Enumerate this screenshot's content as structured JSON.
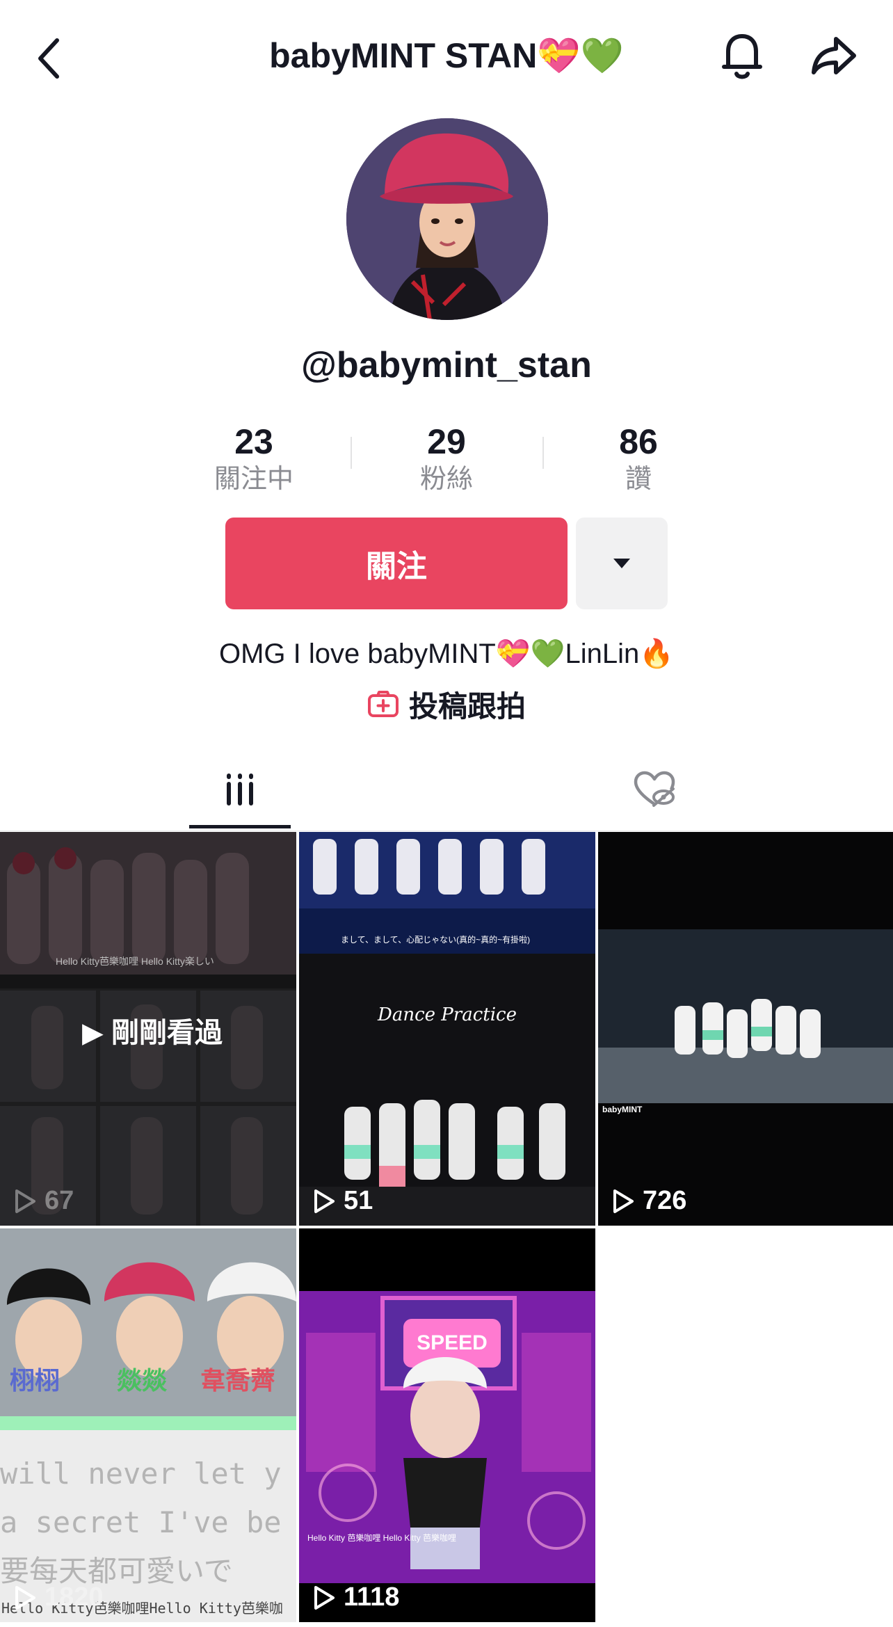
{
  "header": {
    "title": "babyMINT STAN💝💚",
    "back_icon": "chevron-left-icon",
    "bell_icon": "bell-icon",
    "share_icon": "share-arrow-icon"
  },
  "profile": {
    "username": "@babymint_stan",
    "stats": [
      {
        "value": "23",
        "label": "關注中"
      },
      {
        "value": "29",
        "label": "粉絲"
      },
      {
        "value": "86",
        "label": "讚"
      }
    ],
    "follow_label": "關注",
    "bio": "OMG I love babyMINT💝💚LinLin🔥",
    "duet_label": "投稿跟拍"
  },
  "colors": {
    "accent": "#e94560",
    "text": "#161823",
    "muted": "#8a8b91"
  },
  "tabs": [
    {
      "name": "videos",
      "icon": "grid-lines-icon",
      "active": true
    },
    {
      "name": "liked",
      "icon": "liked-hidden-icon",
      "active": false
    }
  ],
  "videos": [
    {
      "views": "67",
      "overlay": "▶ 剛剛看過",
      "caption": "Hello Kitty芭樂咖哩 Hello Kitty楽しい"
    },
    {
      "views": "51",
      "title": "Dance Practice",
      "caption": "まして、まして、心配じゃない(真的~真的~有掛啦)"
    },
    {
      "views": "726",
      "caption": "babyMINT"
    },
    {
      "views": "1820",
      "names": [
        "栩栩",
        "燚燚",
        "韋喬薺"
      ],
      "lines": [
        "will never let y",
        "a secret I've be",
        "要每天都可愛いで"
      ],
      "caption": "Hello Kitty芭樂咖哩Hello Kitty芭樂咖"
    },
    {
      "views": "1118",
      "sign": "SPEED",
      "caption": "Hello Kitty 芭樂咖哩 Hello Kitty 芭樂咖哩"
    }
  ]
}
